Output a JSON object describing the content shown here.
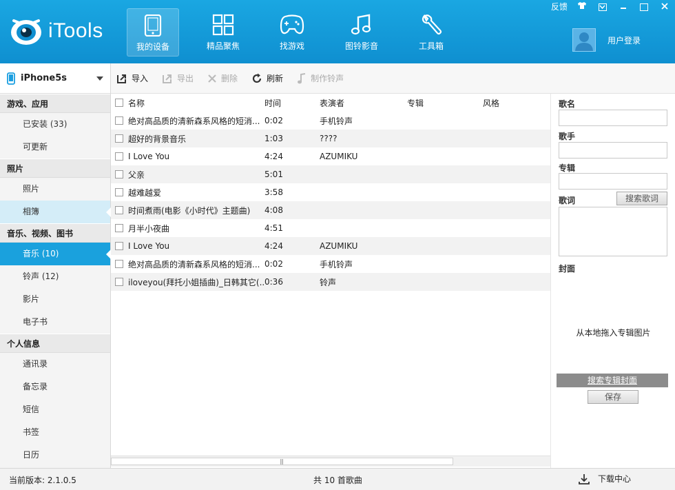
{
  "app": {
    "title": "iTools"
  },
  "topbar": {
    "feedback": "反馈"
  },
  "nav": [
    {
      "label": "我的设备",
      "icon": "device-icon"
    },
    {
      "label": "精品聚焦",
      "icon": "grid-icon"
    },
    {
      "label": "找游戏",
      "icon": "gamepad-icon"
    },
    {
      "label": "图铃影音",
      "icon": "music-note-icon"
    },
    {
      "label": "工具箱",
      "icon": "wrench-icon"
    }
  ],
  "user": {
    "login": "用户登录"
  },
  "sidebar": {
    "device": "iPhone5s",
    "sections": [
      {
        "title": "游戏、应用",
        "items": [
          "已安装 (33)",
          "可更新"
        ]
      },
      {
        "title": "照片",
        "items": [
          "照片",
          "相簿"
        ]
      },
      {
        "title": "音乐、视频、图书",
        "items": [
          "音乐 (10)",
          "铃声 (12)",
          "影片",
          "电子书"
        ]
      },
      {
        "title": "个人信息",
        "items": [
          "通讯录",
          "备忘录",
          "短信",
          "书签",
          "日历"
        ]
      }
    ]
  },
  "toolbar": {
    "import": "导入",
    "export": "导出",
    "delete": "删除",
    "refresh": "刷新",
    "make_ringtone": "制作铃声"
  },
  "table": {
    "headers": [
      "名称",
      "时间",
      "表演者",
      "专辑",
      "风格"
    ],
    "rows": [
      [
        "绝对高品质的清新森系风格的短消...",
        "0:02",
        "手机铃声",
        "",
        ""
      ],
      [
        "超好的背景音乐",
        "1:03",
        "????",
        "",
        ""
      ],
      [
        "I Love You",
        "4:24",
        "AZUMIKU",
        "",
        ""
      ],
      [
        "父亲",
        "5:01",
        "",
        "",
        ""
      ],
      [
        "越难越爱",
        "3:58",
        "",
        "",
        ""
      ],
      [
        "时间煮雨(电影《小时代》主题曲)",
        "4:08",
        "",
        "",
        ""
      ],
      [
        "月半小夜曲",
        "4:51",
        "",
        "",
        ""
      ],
      [
        "I Love You",
        "4:24",
        "AZUMIKU",
        "",
        ""
      ],
      [
        "绝对高品质的清新森系风格的短消...",
        "0:02",
        "手机铃声",
        "",
        ""
      ],
      [
        "iloveyou(拜托小姐插曲)_日韩其它(...",
        "0:36",
        "铃声",
        "",
        ""
      ]
    ]
  },
  "panel": {
    "song_name": "歌名",
    "artist": "歌手",
    "album": "专辑",
    "lyrics": "歌词",
    "search_lyrics": "搜索歌词",
    "cover": "封面",
    "cover_hint": "从本地拖入专辑图片",
    "search_cover": "搜索专辑封面",
    "save": "保存"
  },
  "status": {
    "version": "当前版本: 2.1.0.5",
    "count": "共 10 首歌曲",
    "download_center": "下载中心"
  }
}
